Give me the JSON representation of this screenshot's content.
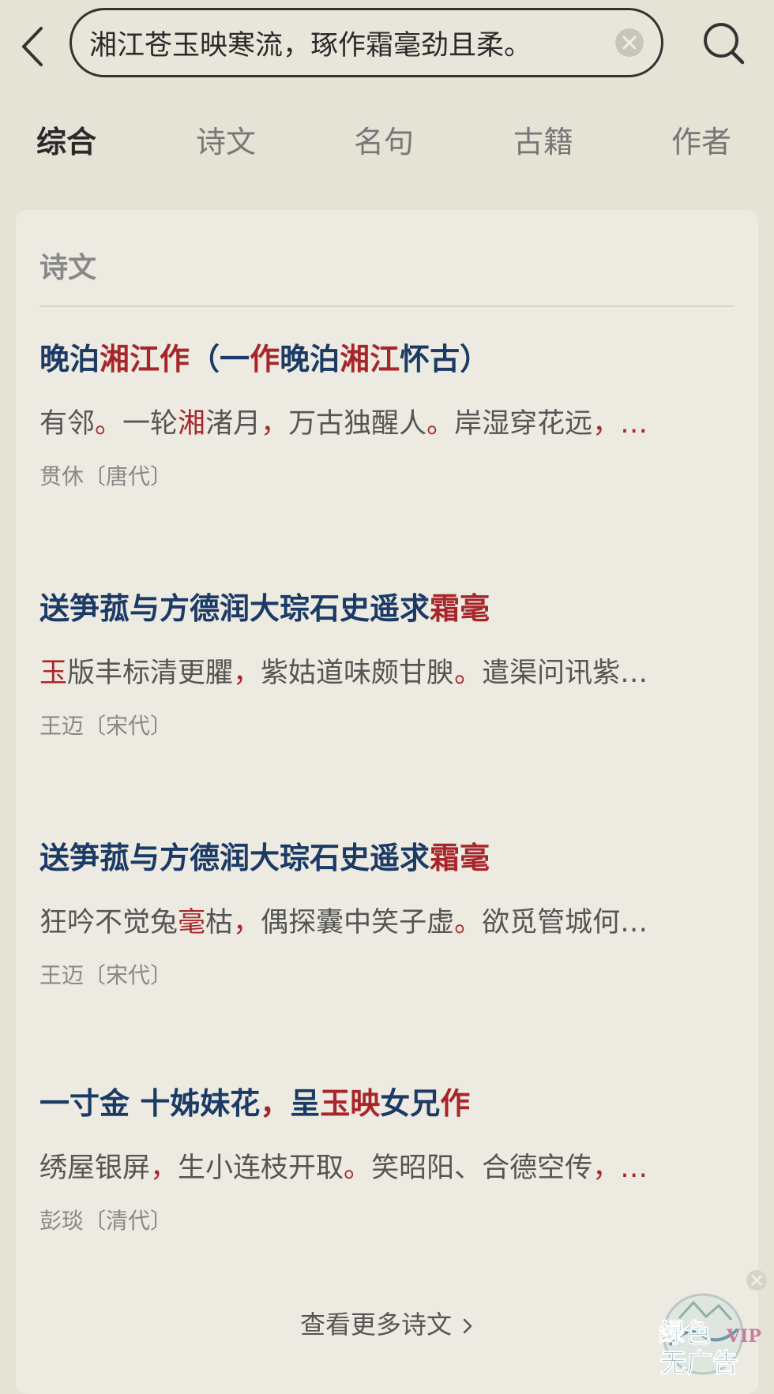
{
  "search": {
    "query": "湘江苍玉映寒流，琢作霜毫劲且柔。"
  },
  "tabs": [
    {
      "label": "综合",
      "active": true
    },
    {
      "label": "诗文",
      "active": false
    },
    {
      "label": "名句",
      "active": false
    },
    {
      "label": "古籍",
      "active": false
    },
    {
      "label": "作者",
      "active": false
    }
  ],
  "section": {
    "title": "诗文",
    "more_label": "查看更多诗文"
  },
  "results": [
    {
      "title": [
        "晚泊",
        {
          "hl": "湘江"
        },
        {
          "hl": "作"
        },
        "（一",
        {
          "hl": "作"
        },
        "晚泊",
        {
          "hl": "湘江"
        },
        "怀古）"
      ],
      "excerpt": [
        "有邻",
        {
          "hl": "。"
        },
        "一轮",
        {
          "hl": "湘"
        },
        "渚月",
        {
          "hl": "，"
        },
        "万古独醒人",
        {
          "hl": "。"
        },
        "岸湿穿花远",
        {
          "hl": "，"
        },
        {
          "hl": "…"
        }
      ],
      "author": "贯休〔唐代〕"
    },
    {
      "title": [
        "送笋菰与方德润大琮石史遥求",
        {
          "hl": "霜毫"
        }
      ],
      "excerpt": [
        {
          "hl": "玉"
        },
        "版丰标清更臞",
        {
          "hl": "，"
        },
        "紫姑道味颇甘腴",
        {
          "hl": "。"
        },
        "遣渠问讯紫…"
      ],
      "author": "王迈〔宋代〕"
    },
    {
      "title": [
        "送笋菰与方德润大琮石史遥求",
        {
          "hl": "霜毫"
        }
      ],
      "excerpt": [
        "狂吟不觉兔",
        {
          "hl": "毫"
        },
        "枯",
        {
          "hl": "，"
        },
        "偶探囊中笑子虚",
        {
          "hl": "。"
        },
        "欲觅管城何…"
      ],
      "author": "王迈〔宋代〕"
    },
    {
      "title": [
        "一寸金 十姊妹花",
        {
          "hl": "，"
        },
        "呈",
        {
          "hl": "玉映"
        },
        "女兄",
        {
          "hl": "作"
        }
      ],
      "excerpt": [
        "绣屋银屏",
        {
          "hl": "，"
        },
        "生小连枝开取",
        {
          "hl": "。"
        },
        "笑昭阳、合德空传",
        {
          "hl": "，"
        },
        {
          "hl": "…"
        }
      ],
      "author": "彭琰〔清代〕"
    }
  ],
  "watermark": {
    "line1": "绿色",
    "line2": "无广告",
    "badge": "VIP"
  },
  "colors": {
    "background": "#e5e2d6",
    "card": "#edebe1",
    "title": "#1b3a66",
    "highlight": "#a8262b"
  },
  "icons": {
    "back": "chevron-left-icon",
    "clear": "clear-circle-icon",
    "search": "search-icon",
    "more": "chevron-right-icon"
  }
}
